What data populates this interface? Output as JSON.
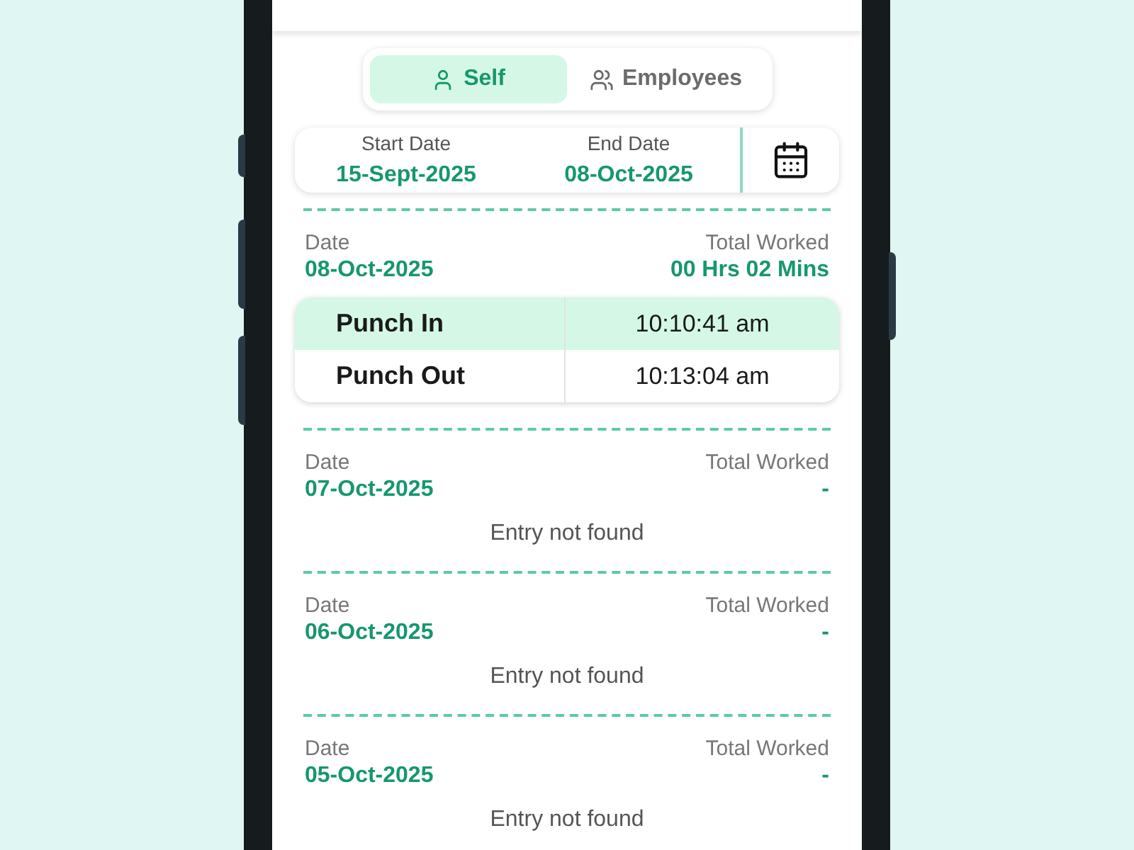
{
  "tabs": [
    {
      "label": "Self",
      "selected": true,
      "kind": "person"
    },
    {
      "label": "Employees",
      "selected": false,
      "kind": "group"
    }
  ],
  "date_range": {
    "start_label": "Start Date",
    "start": "15-Sept-2025",
    "end_label": "End Date",
    "end": "08-Oct-2025"
  },
  "days": [
    {
      "date_label": "Date",
      "date": "08-Oct-2025",
      "total_label": "Total Worked",
      "total": "00 Hrs 02 Mins",
      "punches": [
        {
          "label": "Punch In",
          "time": "10:10:41 am",
          "highlighted": true
        },
        {
          "label": "Punch Out",
          "time": "10:13:04 am",
          "highlighted": false
        }
      ]
    },
    {
      "date_label": "Date",
      "date": "07-Oct-2025",
      "total_label": "Total Worked",
      "total": "-",
      "message": "Entry not found"
    },
    {
      "date_label": "Date",
      "date": "06-Oct-2025",
      "total_label": "Total Worked",
      "total": "-",
      "message": "Entry not found"
    },
    {
      "date_label": "Date",
      "date": "05-Oct-2025",
      "total_label": "Total Worked",
      "total": "-",
      "message": "Entry not found"
    }
  ]
}
